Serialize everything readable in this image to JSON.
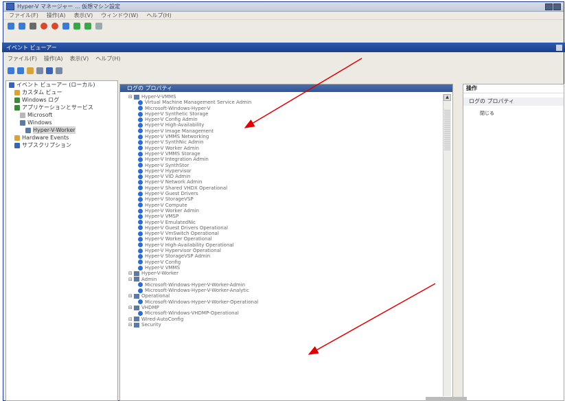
{
  "window": {
    "title": "Hyper-V マネージャー ... 仮想マシン設定",
    "menu": [
      "ファイル(F)",
      "操作(A)",
      "表示(V)",
      "ウィンドウ(W)",
      "ヘルプ(H)"
    ]
  },
  "subwindow": {
    "title": "イベント ビューアー",
    "menu": [
      "ファイル(F)",
      "操作(A)",
      "表示(V)",
      "ヘルプ(H)"
    ]
  },
  "left_tree": [
    {
      "label": "イベント ビューアー (ローカル)",
      "level": 0,
      "color": "#3a63b8"
    },
    {
      "label": "カスタム ビュー",
      "level": 1,
      "color": "#d9a33a"
    },
    {
      "label": "Windows ログ",
      "level": 1,
      "color": "#3a8a3a"
    },
    {
      "label": "アプリケーションとサービス",
      "level": 1,
      "color": "#3a8a3a"
    },
    {
      "label": "Microsoft",
      "level": 2,
      "color": "#b8b8b8"
    },
    {
      "label": "Windows",
      "level": 2,
      "color": "#5c7aa5"
    },
    {
      "label": "Hyper-V-Worker",
      "level": 3,
      "color": "#5c7aa5",
      "selected": true
    },
    {
      "label": "Hardware Events",
      "level": 1,
      "color": "#d9a33a"
    },
    {
      "label": "サブスクリプション",
      "level": 1,
      "color": "#3a63b8"
    }
  ],
  "center": {
    "header": "ログの プロパティ",
    "rows": [
      {
        "t": "Hyper-V-VMMS",
        "k": "group",
        "lv": 0
      },
      {
        "t": "Virtual Machine Management Service Admin",
        "k": "item",
        "lv": 1
      },
      {
        "t": "Microsoft-Windows-Hyper-V",
        "k": "item",
        "lv": 1
      },
      {
        "t": "Hyper-V Synthetic Storage",
        "k": "item",
        "lv": 1
      },
      {
        "t": "Hyper-V Config Admin",
        "k": "item",
        "lv": 1
      },
      {
        "t": "Hyper-V High-Availability",
        "k": "item",
        "lv": 1
      },
      {
        "t": "Hyper-V Image Management",
        "k": "item",
        "lv": 1
      },
      {
        "t": "Hyper-V VMMS Networking",
        "k": "item",
        "lv": 1
      },
      {
        "t": "Hyper-V SynthNic Admin",
        "k": "item",
        "lv": 1
      },
      {
        "t": "Hyper-V Worker Admin",
        "k": "item",
        "lv": 1
      },
      {
        "t": "Hyper-V VMMS Storage",
        "k": "item",
        "lv": 1
      },
      {
        "t": "Hyper-V Integration Admin",
        "k": "item",
        "lv": 1
      },
      {
        "t": "Hyper-V SynthStor",
        "k": "item",
        "lv": 1
      },
      {
        "t": "Hyper-V Hypervisor",
        "k": "item",
        "lv": 1
      },
      {
        "t": "Hyper-V VID Admin",
        "k": "item",
        "lv": 1
      },
      {
        "t": "Hyper-V Network Admin",
        "k": "item",
        "lv": 1
      },
      {
        "t": "Hyper-V Shared VHDX Operational",
        "k": "item",
        "lv": 1
      },
      {
        "t": "Hyper-V Guest Drivers",
        "k": "item",
        "lv": 1
      },
      {
        "t": "Hyper-V StorageVSP",
        "k": "item",
        "lv": 1
      },
      {
        "t": "Hyper-V Compute",
        "k": "item",
        "lv": 1
      },
      {
        "t": "Hyper-V Worker Admin",
        "k": "item",
        "lv": 1
      },
      {
        "t": "Hyper-V VMSP",
        "k": "item",
        "lv": 1
      },
      {
        "t": "Hyper-V EmulatedNic",
        "k": "item",
        "lv": 1
      },
      {
        "t": "Hyper-V Guest Drivers Operational",
        "k": "item",
        "lv": 1
      },
      {
        "t": "Hyper-V VmSwitch Operational",
        "k": "item",
        "lv": 1
      },
      {
        "t": "Hyper-V Worker Operational",
        "k": "item",
        "lv": 1
      },
      {
        "t": "Hyper-V High-Availability Operational",
        "k": "item",
        "lv": 1
      },
      {
        "t": "Hyper-V Hypervisor Operational",
        "k": "item",
        "lv": 1
      },
      {
        "t": "Hyper-V StorageVSP Admin",
        "k": "item",
        "lv": 1
      },
      {
        "t": "Hyper-V Config",
        "k": "item",
        "lv": 1
      },
      {
        "t": "Hyper-V VMMS",
        "k": "item",
        "lv": 1
      },
      {
        "t": "Hyper-V-Worker",
        "k": "group",
        "lv": 0
      },
      {
        "t": "Admin",
        "k": "group",
        "lv": 0
      },
      {
        "t": "Microsoft-Windows-Hyper-V-Worker-Admin",
        "k": "item",
        "lv": 1
      },
      {
        "t": "Microsoft-Windows-Hyper-V-Worker-Analytic",
        "k": "item",
        "lv": 1
      },
      {
        "t": "Operational",
        "k": "group",
        "lv": 0
      },
      {
        "t": "Microsoft-Windows-Hyper-V-Worker-Operational",
        "k": "item",
        "lv": 1
      },
      {
        "t": "VHDMP",
        "k": "group",
        "lv": 0
      },
      {
        "t": "Microsoft-Windows-VHDMP-Operational",
        "k": "item",
        "lv": 1
      },
      {
        "t": "Wired-AutoConfig",
        "k": "group",
        "lv": 0
      },
      {
        "t": "Security",
        "k": "group",
        "lv": 0
      }
    ]
  },
  "right": {
    "title": "操作",
    "section": "ログの プロパティ",
    "item": "閉じる"
  }
}
